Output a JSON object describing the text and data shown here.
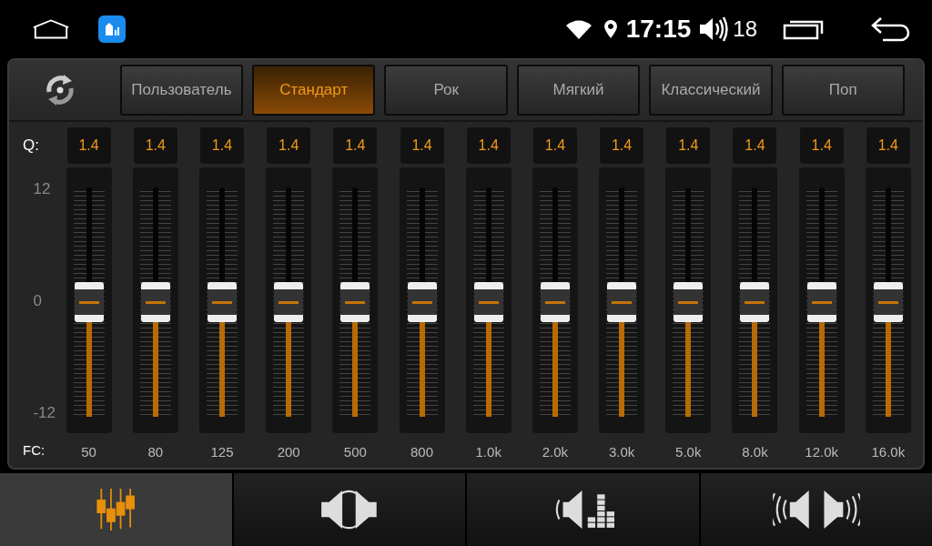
{
  "status_bar": {
    "time": "17:15",
    "volume": "18"
  },
  "presets": [
    {
      "label": "Пользователь",
      "selected": false
    },
    {
      "label": "Стандарт",
      "selected": true
    },
    {
      "label": "Рок",
      "selected": false
    },
    {
      "label": "Мягкий",
      "selected": false
    },
    {
      "label": "Классический",
      "selected": false
    },
    {
      "label": "Поп",
      "selected": false
    }
  ],
  "q_label": "Q:",
  "fc_label": "FC:",
  "scale": [
    "12",
    "0",
    "-12"
  ],
  "bands": [
    {
      "q": "1.4",
      "fc": "50",
      "level": 0.5
    },
    {
      "q": "1.4",
      "fc": "80",
      "level": 0.5
    },
    {
      "q": "1.4",
      "fc": "125",
      "level": 0.5
    },
    {
      "q": "1.4",
      "fc": "200",
      "level": 0.5
    },
    {
      "q": "1.4",
      "fc": "500",
      "level": 0.5
    },
    {
      "q": "1.4",
      "fc": "800",
      "level": 0.5
    },
    {
      "q": "1.4",
      "fc": "1.0k",
      "level": 0.5
    },
    {
      "q": "1.4",
      "fc": "2.0k",
      "level": 0.5
    },
    {
      "q": "1.4",
      "fc": "3.0k",
      "level": 0.5
    },
    {
      "q": "1.4",
      "fc": "5.0k",
      "level": 0.5
    },
    {
      "q": "1.4",
      "fc": "8.0k",
      "level": 0.5
    },
    {
      "q": "1.4",
      "fc": "12.0k",
      "level": 0.5
    },
    {
      "q": "1.4",
      "fc": "16.0k",
      "level": 0.5
    }
  ],
  "bottom_tabs": [
    {
      "kind": "equalizer",
      "selected": true
    },
    {
      "kind": "balance",
      "selected": false
    },
    {
      "kind": "bass",
      "selected": false
    },
    {
      "kind": "surround",
      "selected": false
    }
  ]
}
